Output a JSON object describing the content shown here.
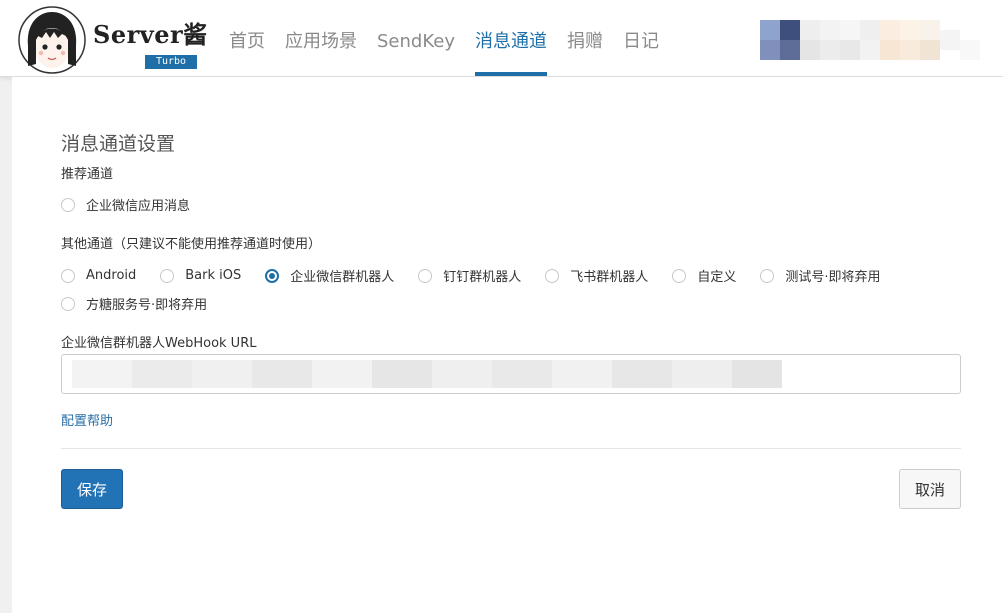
{
  "header": {
    "brand": "Server酱",
    "badge": "Turbo",
    "nav": [
      "首页",
      "应用场景",
      "SendKey",
      "消息通道",
      "捐赠",
      "日记"
    ],
    "active_index": 3
  },
  "settings": {
    "title": "消息通道设置",
    "recommended_label": "推荐通道",
    "recommended_options": [
      {
        "label": "企业微信应用消息",
        "checked": false
      }
    ],
    "other_label": "其他通道（只建议不能使用推荐通道时使用）",
    "other_options": [
      {
        "label": "Android",
        "checked": false
      },
      {
        "label": "Bark iOS",
        "checked": false
      },
      {
        "label": "企业微信群机器人",
        "checked": true
      },
      {
        "label": "钉钉群机器人",
        "checked": false
      },
      {
        "label": "飞书群机器人",
        "checked": false
      },
      {
        "label": "自定义",
        "checked": false
      },
      {
        "label": "测试号·即将弃用",
        "checked": false
      },
      {
        "label": "方糖服务号·即将弃用",
        "checked": false
      }
    ],
    "webhook_label": "企业微信群机器人WebHook URL",
    "webhook_value": "",
    "help_link": "配置帮助",
    "save_label": "保存",
    "cancel_label": "取消"
  },
  "colors": {
    "accent": "#1e6fa8",
    "nav_inactive": "#8a8a8a"
  }
}
